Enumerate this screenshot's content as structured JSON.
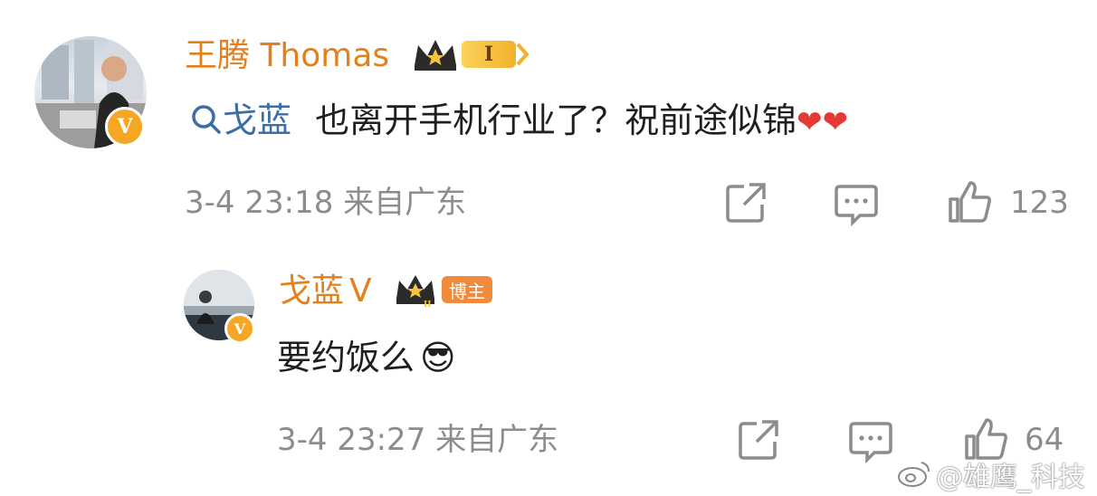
{
  "comment": {
    "author": "王腾 Thomas",
    "level": "I",
    "mention": "戈蓝",
    "text": "也离开手机行业了？祝前途似锦",
    "hearts": "❤❤",
    "time_location": "3-4 23:18  来自广东",
    "like_count": "123"
  },
  "reply": {
    "author": "戈蓝",
    "verified_mark": "V",
    "level": "II",
    "role_badge": "博主",
    "text": "要约饭么",
    "emoji": "😎",
    "time_location": "3-4 23:27  来自广东",
    "like_count": "64"
  },
  "watermark": "@雄鹰_科技",
  "colors": {
    "name": "#e3801d",
    "mention": "#3b6ea8",
    "meta": "#8c8c8c",
    "badge": "#f5a623"
  }
}
